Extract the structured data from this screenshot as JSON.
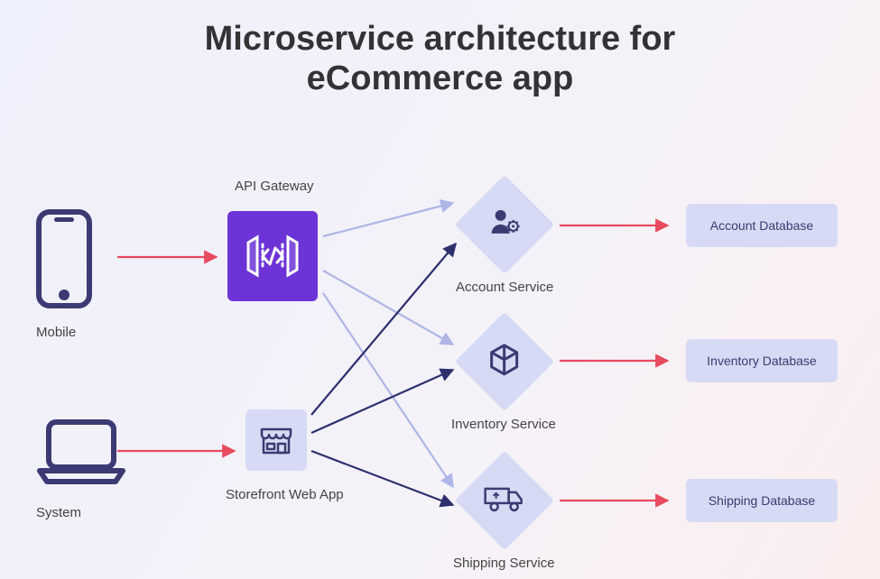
{
  "title_line1": "Microservice architecture for",
  "title_line2": "eCommerce app",
  "clients": {
    "mobile": {
      "label": "Mobile"
    },
    "system": {
      "label": "System"
    }
  },
  "middle": {
    "api_gateway": {
      "label": "API Gateway"
    },
    "storefront": {
      "label": "Storefront Web App"
    }
  },
  "services": {
    "account": {
      "label": "Account Service"
    },
    "inventory": {
      "label": "Inventory Service"
    },
    "shipping": {
      "label": "Shipping Service"
    }
  },
  "databases": {
    "account": {
      "label": "Account Database"
    },
    "inventory": {
      "label": "Inventory Database"
    },
    "shipping": {
      "label": "Shipping Database"
    }
  },
  "colors": {
    "arrow_red": "#e84a5f",
    "arrow_light": "#aeb6e6",
    "arrow_dark": "#2c2f6e",
    "icon_dark": "#3c3a72",
    "gateway_bg": "#6c34d6"
  }
}
